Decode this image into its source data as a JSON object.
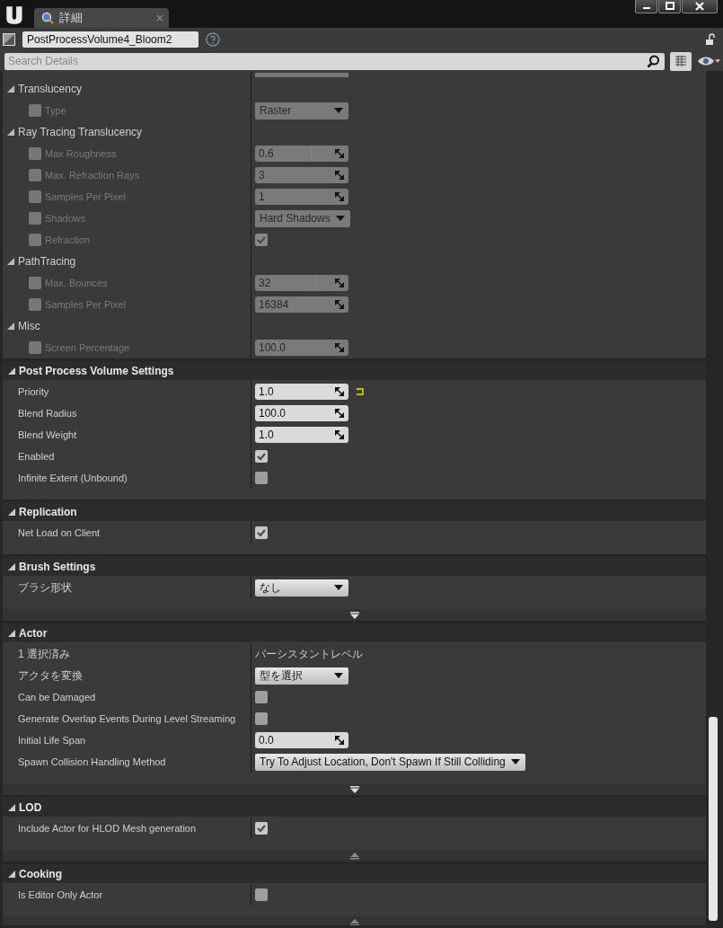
{
  "title_bar": {
    "tabs": [
      {
        "label": "詳細",
        "selected": true
      }
    ]
  },
  "details": {
    "object_name": "PostProcessVolume4_Bloom2",
    "locked": false,
    "search": {
      "placeholder": "Search Details"
    }
  },
  "sections": [
    {
      "items": [
        {
          "kind": "clipped"
        },
        {
          "kind": "group",
          "label": "Translucency"
        },
        {
          "kind": "property",
          "label": "Type",
          "override_checked": false,
          "disabled": true,
          "value": {
            "kind": "select",
            "text": "Raster"
          }
        },
        {
          "kind": "group",
          "label": "Ray Tracing Translucency"
        },
        {
          "kind": "property",
          "label": "Max Roughness",
          "override_checked": false,
          "disabled": true,
          "value": {
            "kind": "number",
            "text": "0.6",
            "level": 0.6
          }
        },
        {
          "kind": "property",
          "label": "Max. Refraction Rays",
          "override_checked": false,
          "disabled": true,
          "value": {
            "kind": "number",
            "text": "3"
          }
        },
        {
          "kind": "property",
          "label": "Samples Per Pixel",
          "override_checked": false,
          "disabled": true,
          "value": {
            "kind": "number",
            "text": "1"
          }
        },
        {
          "kind": "property",
          "label": "Shadows",
          "override_checked": false,
          "disabled": true,
          "value": {
            "kind": "select",
            "text": "Hard Shadows"
          }
        },
        {
          "kind": "property",
          "label": "Refraction",
          "override_checked": false,
          "disabled": true,
          "value": {
            "kind": "checkbox",
            "checked": true
          }
        },
        {
          "kind": "group",
          "label": "PathTracing"
        },
        {
          "kind": "property",
          "label": "Max. Bounces",
          "override_checked": false,
          "disabled": true,
          "value": {
            "kind": "number",
            "text": "32",
            "level": 0.64
          }
        },
        {
          "kind": "property",
          "label": "Samples Per Pixel",
          "override_checked": false,
          "disabled": true,
          "value": {
            "kind": "number",
            "text": "16384"
          }
        },
        {
          "kind": "group",
          "label": "Misc"
        },
        {
          "kind": "property",
          "label": "Screen Percentage",
          "override_checked": false,
          "disabled": true,
          "value": {
            "kind": "number",
            "text": "100.0",
            "level": 0.23
          }
        }
      ]
    },
    {
      "title": "Post Process Volume Settings",
      "items": [
        {
          "kind": "property",
          "label": "Priority",
          "disabled": false,
          "reset_to_default": true,
          "value": {
            "kind": "number",
            "text": "1.0"
          }
        },
        {
          "kind": "property",
          "label": "Blend Radius",
          "disabled": false,
          "value": {
            "kind": "number",
            "text": "100.0"
          }
        },
        {
          "kind": "property",
          "label": "Blend Weight",
          "disabled": false,
          "value": {
            "kind": "number",
            "text": "1.0"
          }
        },
        {
          "kind": "property",
          "label": "Enabled",
          "disabled": false,
          "value": {
            "kind": "checkbox",
            "checked": true
          }
        },
        {
          "kind": "property",
          "label": "Infinite Extent (Unbound)",
          "disabled": false,
          "value": {
            "kind": "checkbox",
            "checked": false
          }
        }
      ]
    },
    {
      "title": "Replication",
      "items": [
        {
          "kind": "property",
          "label": "Net Load on Client",
          "disabled": false,
          "value": {
            "kind": "checkbox",
            "checked": true
          }
        }
      ]
    },
    {
      "title": "Brush Settings",
      "advanced": {
        "expanded": false
      },
      "items": [
        {
          "kind": "property",
          "label": "ブラシ形状",
          "disabled": false,
          "value": {
            "kind": "select",
            "text": "なし"
          }
        }
      ]
    },
    {
      "title": "Actor",
      "advanced": {
        "expanded": false
      },
      "items": [
        {
          "kind": "property",
          "label": "1 選択済み",
          "disabled": false,
          "value": {
            "kind": "text",
            "text": "パーシスタントレベル"
          }
        },
        {
          "kind": "property",
          "label": "アクタを変換",
          "disabled": false,
          "value": {
            "kind": "select",
            "text": "型を選択"
          }
        },
        {
          "kind": "property",
          "label": "Can be Damaged",
          "disabled": false,
          "value": {
            "kind": "checkbox",
            "checked": false
          }
        },
        {
          "kind": "property",
          "label": "Generate Overlap Events During Level Streaming",
          "disabled": false,
          "value": {
            "kind": "checkbox",
            "checked": false
          }
        },
        {
          "kind": "property",
          "label": "Initial Life Span",
          "disabled": false,
          "value": {
            "kind": "number",
            "text": "0.0"
          }
        },
        {
          "kind": "property",
          "label": "Spawn Collision Handling Method",
          "disabled": false,
          "value": {
            "kind": "select",
            "text": "Try To Adjust Location, Don't Spawn If Still Colliding"
          }
        }
      ]
    },
    {
      "title": "LOD",
      "advanced": {
        "expanded": true
      },
      "items": [
        {
          "kind": "property",
          "label": "Include Actor for HLOD Mesh generation",
          "disabled": false,
          "value": {
            "kind": "checkbox",
            "checked": true
          }
        }
      ]
    },
    {
      "title": "Cooking",
      "advanced": {
        "expanded": true
      },
      "items": [
        {
          "kind": "property",
          "label": "Is Editor Only Actor",
          "disabled": false,
          "value": {
            "kind": "checkbox",
            "checked": false
          }
        }
      ]
    }
  ]
}
